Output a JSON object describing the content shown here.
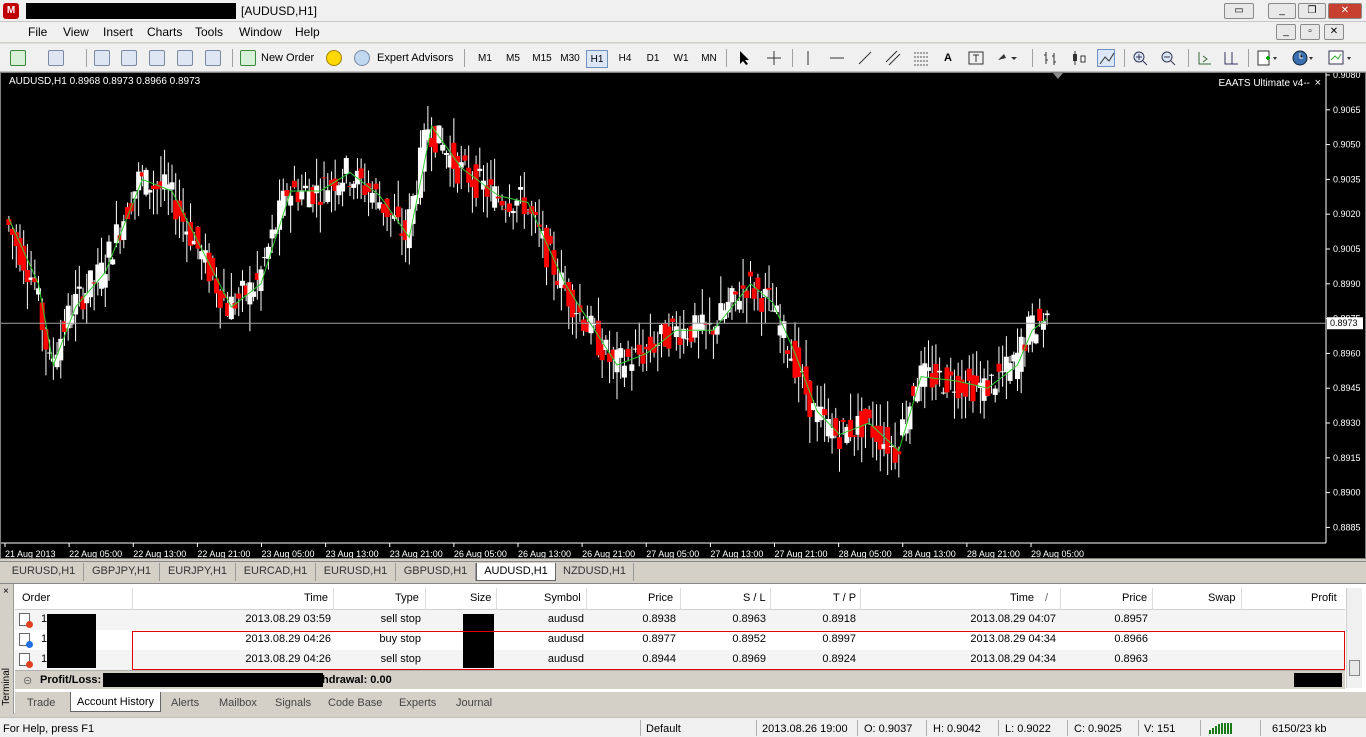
{
  "window": {
    "title": "[AUDUSD,H1]",
    "min": "▭",
    "restore": "❐",
    "close": "✕",
    "min2": "_",
    "restore2": "▫",
    "close2": "✕"
  },
  "menu": [
    "File",
    "View",
    "Insert",
    "Charts",
    "Tools",
    "Window",
    "Help"
  ],
  "toolbar": {
    "new_order": "New Order",
    "expert_advisors": "Expert Advisors",
    "timeframes": [
      "M1",
      "M5",
      "M15",
      "M30",
      "H1",
      "H4",
      "D1",
      "W1",
      "MN"
    ],
    "active_timeframe": "H1"
  },
  "chart": {
    "header": "AUDUSD,H1  0.8968 0.8973 0.8966 0.8973",
    "ea": "EAATS Ultimate v4--",
    "ea_close": "×",
    "current_price": "0.8973",
    "price_ticks": [
      "0.9080",
      "0.9065",
      "0.9050",
      "0.9035",
      "0.9020",
      "0.9005",
      "0.8990",
      "0.8975",
      "0.8960",
      "0.8945",
      "0.8930",
      "0.8915",
      "0.8900",
      "0.8885"
    ],
    "time_ticks": [
      "21 Aug 2013",
      "22 Aug 05:00",
      "22 Aug 13:00",
      "22 Aug 21:00",
      "23 Aug 05:00",
      "23 Aug 13:00",
      "23 Aug 21:00",
      "26 Aug 05:00",
      "26 Aug 13:00",
      "26 Aug 21:00",
      "27 Aug 05:00",
      "27 Aug 13:00",
      "27 Aug 21:00",
      "28 Aug 05:00",
      "28 Aug 13:00",
      "28 Aug 21:00",
      "29 Aug 05:00"
    ],
    "colors": {
      "bull": "#ffffff",
      "bear": "#ff0000",
      "ma": "#32cd32",
      "bg": "#000000"
    }
  },
  "chart_tabs": [
    "EURUSD,H1",
    "GBPJPY,H1",
    "EURJPY,H1",
    "EURCAD,H1",
    "EURUSD,H1",
    "GBPUSD,H1",
    "AUDUSD,H1",
    "NZDUSD,H1"
  ],
  "active_chart_tab": "AUDUSD,H1",
  "terminal": {
    "side_label": "Terminal",
    "close": "×",
    "columns": {
      "order": "Order",
      "time": "Time",
      "type": "Type",
      "size": "Size",
      "symbol": "Symbol",
      "price": "Price",
      "sl": "S / L",
      "tp": "T / P",
      "time2": "Time",
      "sort_arrow": "/",
      "price2": "Price",
      "swap": "Swap",
      "profit": "Profit"
    },
    "rows": [
      {
        "order": "1",
        "time": "2013.08.29 03:59",
        "type": "sell stop",
        "symbol": "audusd",
        "price": "0.8938",
        "sl": "0.8963",
        "tp": "0.8918",
        "time2": "2013.08.29 04:07",
        "price2": "0.8957",
        "swap": "",
        "profit": ""
      },
      {
        "order": "1",
        "time": "2013.08.29 04:26",
        "type": "buy stop",
        "symbol": "audusd",
        "price": "0.8977",
        "sl": "0.8952",
        "tp": "0.8997",
        "time2": "2013.08.29 04:34",
        "price2": "0.8966",
        "swap": "",
        "profit": ""
      },
      {
        "order": "1",
        "time": "2013.08.29 04:26",
        "type": "sell stop",
        "symbol": "audusd",
        "price": "0.8944",
        "sl": "0.8969",
        "tp": "0.8924",
        "time2": "2013.08.29 04:34",
        "price2": "0.8963",
        "swap": "",
        "profit": ""
      }
    ],
    "pl_label": "Profit/Loss:",
    "withdrawal": "Withdrawal: 0.00",
    "tabs": [
      "Trade",
      "Account History",
      "Alerts",
      "Mailbox",
      "Signals",
      "Code Base",
      "Experts",
      "Journal"
    ],
    "active_tab": "Account History"
  },
  "status": {
    "help": "For Help, press F1",
    "profile": "Default",
    "datetime": "2013.08.26 19:00",
    "open": "O: 0.9037",
    "high": "H: 0.9042",
    "low": "L: 0.9022",
    "close": "C: 0.9025",
    "volume": "V: 151",
    "traffic": "6150/23 kb"
  }
}
